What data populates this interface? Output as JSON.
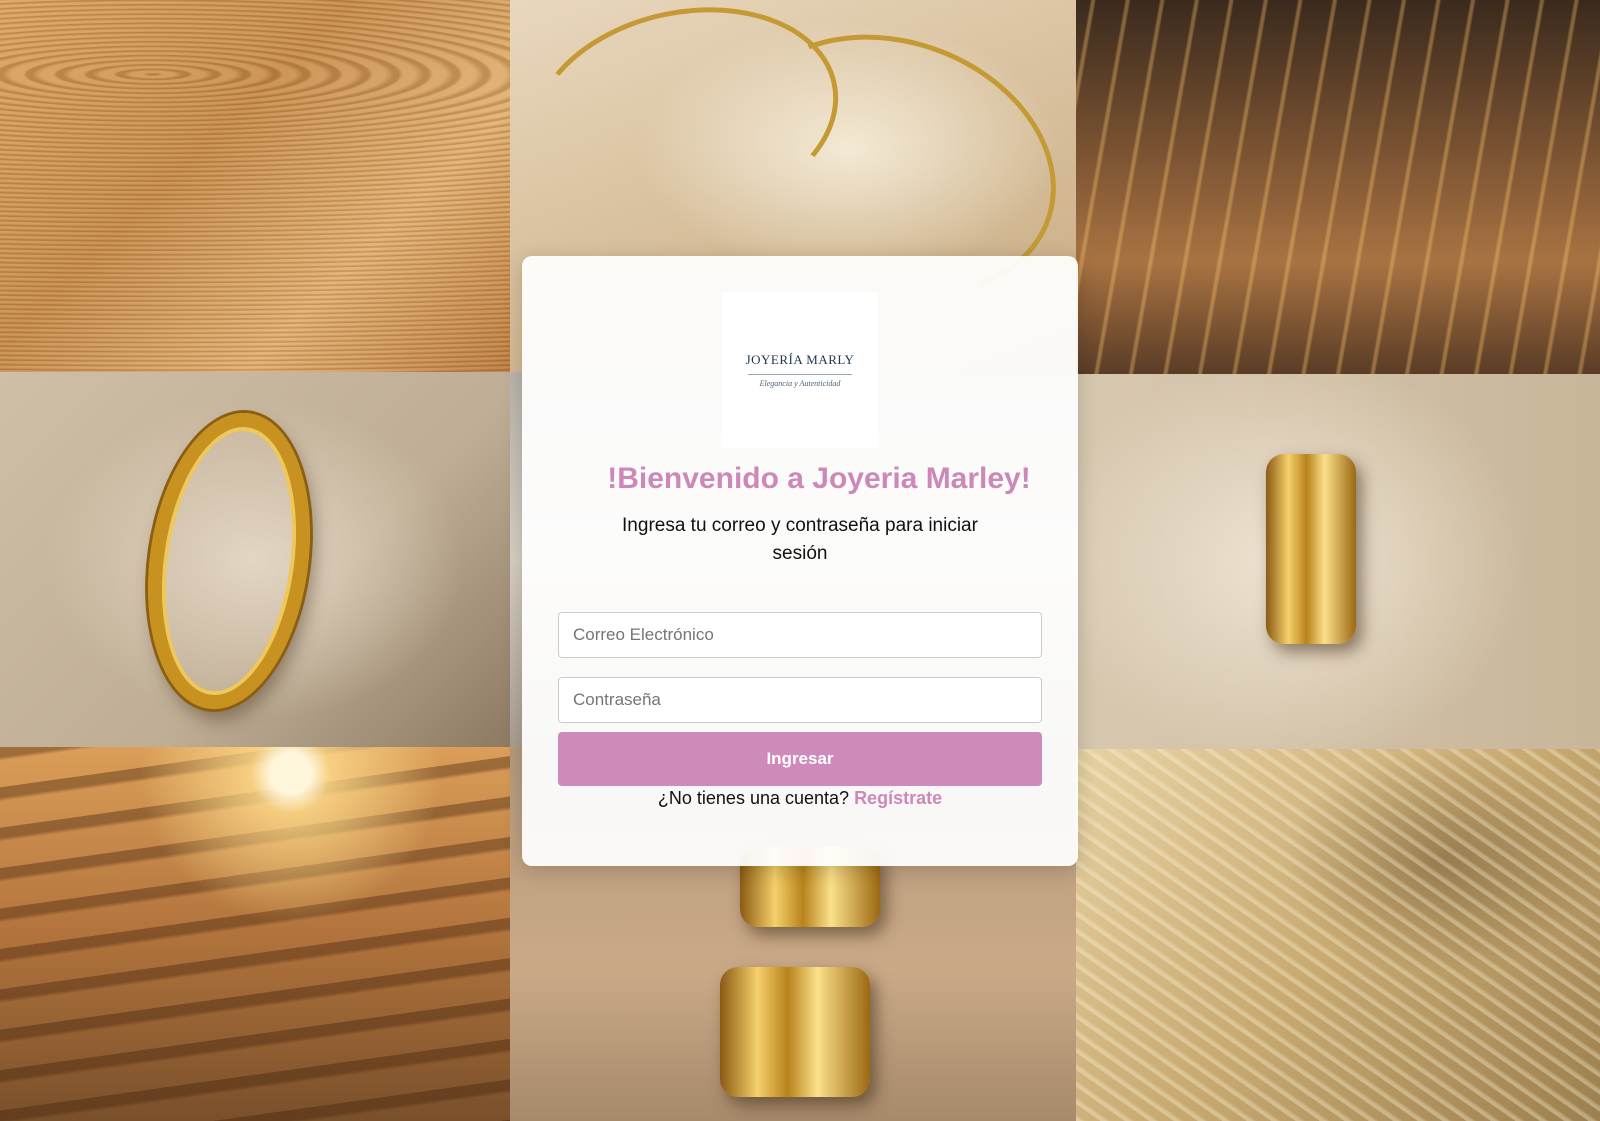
{
  "brand": {
    "logo_name": "JOYERÍA MARLY",
    "logo_tagline": "Elegancia y Autenticidad"
  },
  "login": {
    "welcome_title": "!Bienvenido a Joyeria Marley!",
    "subtitle": "Ingresa tu correo y contraseña para iniciar sesión",
    "email_placeholder": "Correo Electrónico",
    "password_placeholder": "Contraseña",
    "submit_label": "Ingresar",
    "register_prompt": "¿No tienes una cuenta?",
    "register_link": "Regístrate"
  },
  "colors": {
    "accent": "#cc88b9",
    "button": "#cd8abb",
    "logo_text": "#1f3550"
  },
  "background": {
    "tiles": [
      "sand-dunes",
      "gold-chains",
      "sunlit-water",
      "gold-ring",
      "pale-texture",
      "gold-ring",
      "sunset-blinds",
      "gold-earrings",
      "palm-water"
    ]
  }
}
